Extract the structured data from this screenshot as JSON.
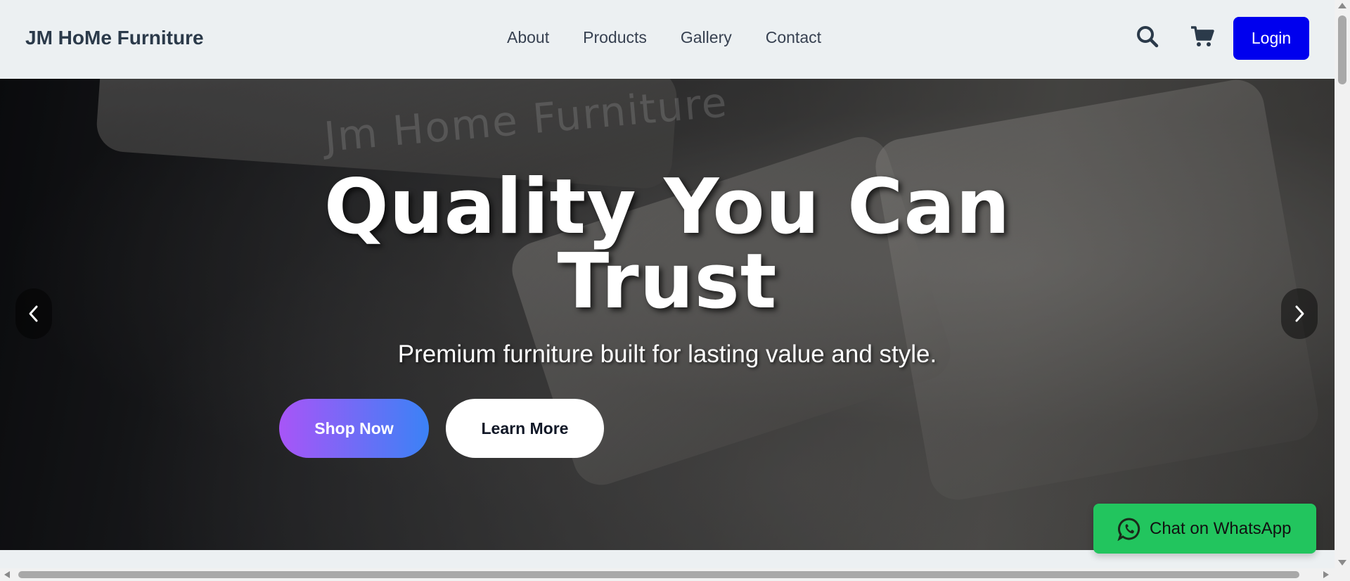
{
  "header": {
    "brand": "JM HoMe Furniture",
    "nav": [
      {
        "label": "About"
      },
      {
        "label": "Products"
      },
      {
        "label": "Gallery"
      },
      {
        "label": "Contact"
      }
    ],
    "search_icon": "search-icon",
    "cart_icon": "cart-icon",
    "login_label": "Login",
    "login_color": "#0000ee"
  },
  "hero": {
    "watermark": "Jm Home Furniture",
    "headline_line1": "Quality You Can",
    "headline_line2": "Trust",
    "subline": "Premium furniture built for lasting value and style.",
    "shop_label": "Shop Now",
    "learn_label": "Learn More",
    "prev_icon": "chevron-left-icon",
    "next_icon": "chevron-right-icon",
    "shop_gradient": [
      "#a855f7",
      "#3b82f6"
    ]
  },
  "whatsapp": {
    "label": "Chat on WhatsApp",
    "icon": "whatsapp-icon",
    "color": "#22c55e"
  }
}
